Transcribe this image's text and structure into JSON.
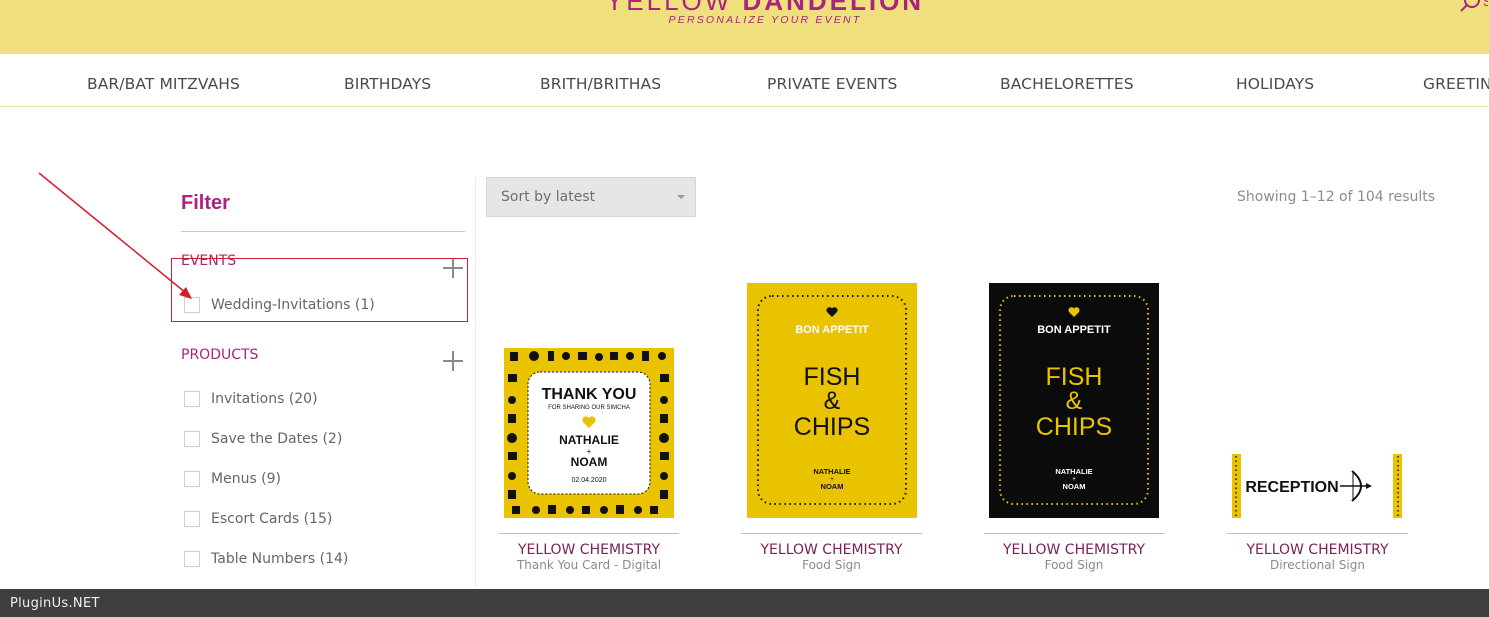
{
  "header": {
    "brand_light": "YELLOW ",
    "brand_bold": "DANDELION",
    "tagline": "PERSONALIZE YOUR EVENT",
    "search_icon": "search-icon",
    "colors": {
      "band": "#f0df7d",
      "brand": "#a8247f"
    }
  },
  "nav": {
    "items": [
      {
        "label": "BAR/BAT MITZVAHS"
      },
      {
        "label": "BIRTHDAYS"
      },
      {
        "label": "BRITH/BRITHAS"
      },
      {
        "label": "PRIVATE EVENTS"
      },
      {
        "label": "BACHELORETTES"
      },
      {
        "label": "HOLIDAYS"
      },
      {
        "label": "GREETING"
      }
    ]
  },
  "filter": {
    "title": "Filter",
    "groups": [
      {
        "title": "EVENTS",
        "options": [
          {
            "label": "Wedding-Invitations (1)"
          }
        ]
      },
      {
        "title": "PRODUCTS",
        "options": [
          {
            "label": "Invitations (20)"
          },
          {
            "label": "Save the Dates (2)"
          },
          {
            "label": "Menus (9)"
          },
          {
            "label": "Escort Cards (15)"
          },
          {
            "label": "Table Numbers (14)"
          }
        ]
      }
    ]
  },
  "toolbar": {
    "sort_value": "Sort by latest",
    "result_count": "Showing 1–12 of 104 results"
  },
  "products": [
    {
      "brand": "YELLOW CHEMISTRY",
      "type": "Thank You Card - Digital",
      "art": {
        "title": "THANK YOU",
        "subtitle": "FOR SHARING OUR SIMCHA",
        "name1": "NATHALIE",
        "amp": "+",
        "name2": "NOAM",
        "date": "02.04.2020"
      }
    },
    {
      "brand": "YELLOW CHEMISTRY",
      "type": "Food Sign",
      "art": {
        "heading": "BON APPETIT",
        "line1": "FISH",
        "line2": "&",
        "line3": "CHIPS",
        "name1": "NATHALIE",
        "amp": "+",
        "name2": "NOAM"
      }
    },
    {
      "brand": "YELLOW CHEMISTRY",
      "type": "Food Sign",
      "art": {
        "heading": "BON APPETIT",
        "line1": "FISH",
        "line2": "&",
        "line3": "CHIPS",
        "name1": "NATHALIE",
        "amp": "+",
        "name2": "NOAM"
      }
    },
    {
      "brand": "YELLOW CHEMISTRY",
      "type": "Directional Sign",
      "art": {
        "label": "RECEPTION"
      }
    }
  ],
  "footer": {
    "text": "PluginUs.NET"
  },
  "colors": {
    "accent": "#a8247f",
    "card_yellow": "#e9c300",
    "annotation_red": "#d0202a"
  }
}
